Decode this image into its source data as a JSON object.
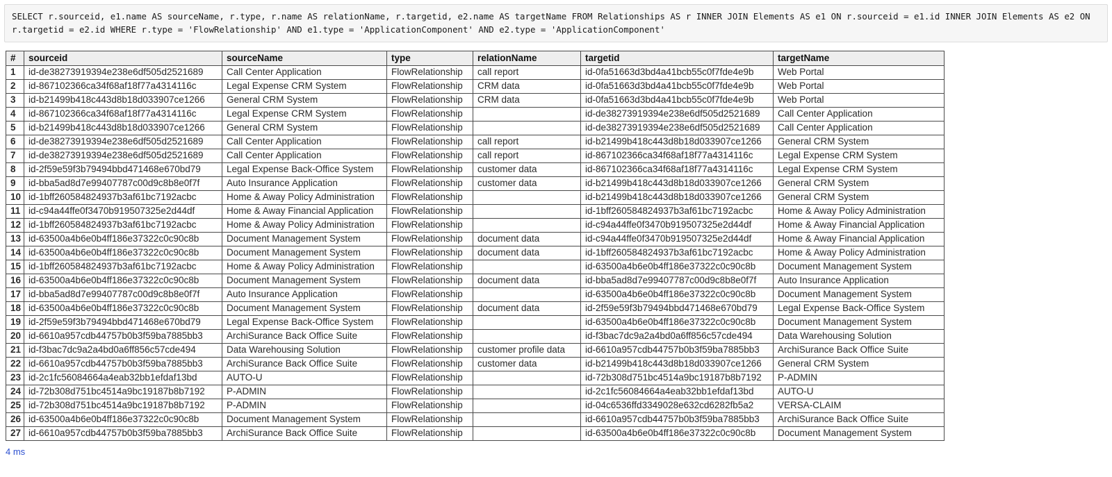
{
  "query": {
    "sql": "SELECT r.sourceid, e1.name AS sourceName, r.type, r.name AS relationName, r.targetid, e2.name AS targetName FROM Relationships AS r INNER JOIN Elements AS e1 ON r.sourceid = e1.id INNER JOIN Elements AS e2 ON r.targetid = e2.id WHERE r.type = 'FlowRelationship' AND e1.type = 'ApplicationComponent' AND e2.type = 'ApplicationComponent'"
  },
  "results": {
    "columns": [
      "#",
      "sourceid",
      "sourceName",
      "type",
      "relationName",
      "targetid",
      "targetName"
    ],
    "rows": [
      [
        "1",
        "id-de38273919394e238e6df505d2521689",
        "Call Center Application",
        "FlowRelationship",
        "call report",
        "id-0fa51663d3bd4a41bcb55c0f7fde4e9b",
        "Web Portal"
      ],
      [
        "2",
        "id-867102366ca34f68af18f77a4314116c",
        "Legal Expense CRM System",
        "FlowRelationship",
        "CRM data",
        "id-0fa51663d3bd4a41bcb55c0f7fde4e9b",
        "Web Portal"
      ],
      [
        "3",
        "id-b21499b418c443d8b18d033907ce1266",
        "General CRM System",
        "FlowRelationship",
        "CRM data",
        "id-0fa51663d3bd4a41bcb55c0f7fde4e9b",
        "Web Portal"
      ],
      [
        "4",
        "id-867102366ca34f68af18f77a4314116c",
        "Legal Expense CRM System",
        "FlowRelationship",
        "",
        "id-de38273919394e238e6df505d2521689",
        "Call Center Application"
      ],
      [
        "5",
        "id-b21499b418c443d8b18d033907ce1266",
        "General CRM System",
        "FlowRelationship",
        "",
        "id-de38273919394e238e6df505d2521689",
        "Call Center Application"
      ],
      [
        "6",
        "id-de38273919394e238e6df505d2521689",
        "Call Center Application",
        "FlowRelationship",
        "call report",
        "id-b21499b418c443d8b18d033907ce1266",
        "General CRM System"
      ],
      [
        "7",
        "id-de38273919394e238e6df505d2521689",
        "Call Center Application",
        "FlowRelationship",
        "call report",
        "id-867102366ca34f68af18f77a4314116c",
        "Legal Expense CRM System"
      ],
      [
        "8",
        "id-2f59e59f3b79494bbd471468e670bd79",
        "Legal Expense Back-Office System",
        "FlowRelationship",
        "customer data",
        "id-867102366ca34f68af18f77a4314116c",
        "Legal Expense CRM System"
      ],
      [
        "9",
        "id-bba5ad8d7e99407787c00d9c8b8e0f7f",
        "Auto Insurance Application",
        "FlowRelationship",
        "customer data",
        "id-b21499b418c443d8b18d033907ce1266",
        "General CRM System"
      ],
      [
        "10",
        "id-1bff260584824937b3af61bc7192acbc",
        "Home & Away Policy Administration",
        "FlowRelationship",
        "",
        "id-b21499b418c443d8b18d033907ce1266",
        "General CRM System"
      ],
      [
        "11",
        "id-c94a44ffe0f3470b919507325e2d44df",
        "Home & Away Financial Application",
        "FlowRelationship",
        "",
        "id-1bff260584824937b3af61bc7192acbc",
        "Home & Away Policy Administration"
      ],
      [
        "12",
        "id-1bff260584824937b3af61bc7192acbc",
        "Home & Away Policy Administration",
        "FlowRelationship",
        "",
        "id-c94a44ffe0f3470b919507325e2d44df",
        "Home & Away Financial Application"
      ],
      [
        "13",
        "id-63500a4b6e0b4ff186e37322c0c90c8b",
        "Document Management System",
        "FlowRelationship",
        "document data",
        "id-c94a44ffe0f3470b919507325e2d44df",
        "Home & Away Financial Application"
      ],
      [
        "14",
        "id-63500a4b6e0b4ff186e37322c0c90c8b",
        "Document Management System",
        "FlowRelationship",
        "document data",
        "id-1bff260584824937b3af61bc7192acbc",
        "Home & Away Policy Administration"
      ],
      [
        "15",
        "id-1bff260584824937b3af61bc7192acbc",
        "Home & Away Policy Administration",
        "FlowRelationship",
        "",
        "id-63500a4b6e0b4ff186e37322c0c90c8b",
        "Document Management System"
      ],
      [
        "16",
        "id-63500a4b6e0b4ff186e37322c0c90c8b",
        "Document Management System",
        "FlowRelationship",
        "document data",
        "id-bba5ad8d7e99407787c00d9c8b8e0f7f",
        "Auto Insurance Application"
      ],
      [
        "17",
        "id-bba5ad8d7e99407787c00d9c8b8e0f7f",
        "Auto Insurance Application",
        "FlowRelationship",
        "",
        "id-63500a4b6e0b4ff186e37322c0c90c8b",
        "Document Management System"
      ],
      [
        "18",
        "id-63500a4b6e0b4ff186e37322c0c90c8b",
        "Document Management System",
        "FlowRelationship",
        "document data",
        "id-2f59e59f3b79494bbd471468e670bd79",
        "Legal Expense Back-Office System"
      ],
      [
        "19",
        "id-2f59e59f3b79494bbd471468e670bd79",
        "Legal Expense Back-Office System",
        "FlowRelationship",
        "",
        "id-63500a4b6e0b4ff186e37322c0c90c8b",
        "Document Management System"
      ],
      [
        "20",
        "id-6610a957cdb44757b0b3f59ba7885bb3",
        "ArchiSurance Back Office Suite",
        "FlowRelationship",
        "",
        "id-f3bac7dc9a2a4bd0a6ff856c57cde494",
        "Data Warehousing Solution"
      ],
      [
        "21",
        "id-f3bac7dc9a2a4bd0a6ff856c57cde494",
        "Data Warehousing Solution",
        "FlowRelationship",
        "customer profile data",
        "id-6610a957cdb44757b0b3f59ba7885bb3",
        "ArchiSurance Back Office Suite"
      ],
      [
        "22",
        "id-6610a957cdb44757b0b3f59ba7885bb3",
        "ArchiSurance Back Office Suite",
        "FlowRelationship",
        "customer data",
        "id-b21499b418c443d8b18d033907ce1266",
        "General CRM System"
      ],
      [
        "23",
        "id-2c1fc56084664a4eab32bb1efdaf13bd",
        "AUTO-U",
        "FlowRelationship",
        "",
        "id-72b308d751bc4514a9bc19187b8b7192",
        "P-ADMIN"
      ],
      [
        "24",
        "id-72b308d751bc4514a9bc19187b8b7192",
        "P-ADMIN",
        "FlowRelationship",
        "",
        "id-2c1fc56084664a4eab32bb1efdaf13bd",
        "AUTO-U"
      ],
      [
        "25",
        "id-72b308d751bc4514a9bc19187b8b7192",
        "P-ADMIN",
        "FlowRelationship",
        "",
        "id-04c6536ffd3349028e632cd6282fb5a2",
        "VERSA-CLAIM"
      ],
      [
        "26",
        "id-63500a4b6e0b4ff186e37322c0c90c8b",
        "Document Management System",
        "FlowRelationship",
        "",
        "id-6610a957cdb44757b0b3f59ba7885bb3",
        "ArchiSurance Back Office Suite"
      ],
      [
        "27",
        "id-6610a957cdb44757b0b3f59ba7885bb3",
        "ArchiSurance Back Office Suite",
        "FlowRelationship",
        "",
        "id-63500a4b6e0b4ff186e37322c0c90c8b",
        "Document Management System"
      ]
    ]
  },
  "footer": {
    "elapsed": "4 ms"
  },
  "colors": {
    "header_background": "#eeeeee",
    "sql_background": "#f6f6f6",
    "footer_text": "#2b4fd0",
    "border": "#4a4a4a"
  }
}
